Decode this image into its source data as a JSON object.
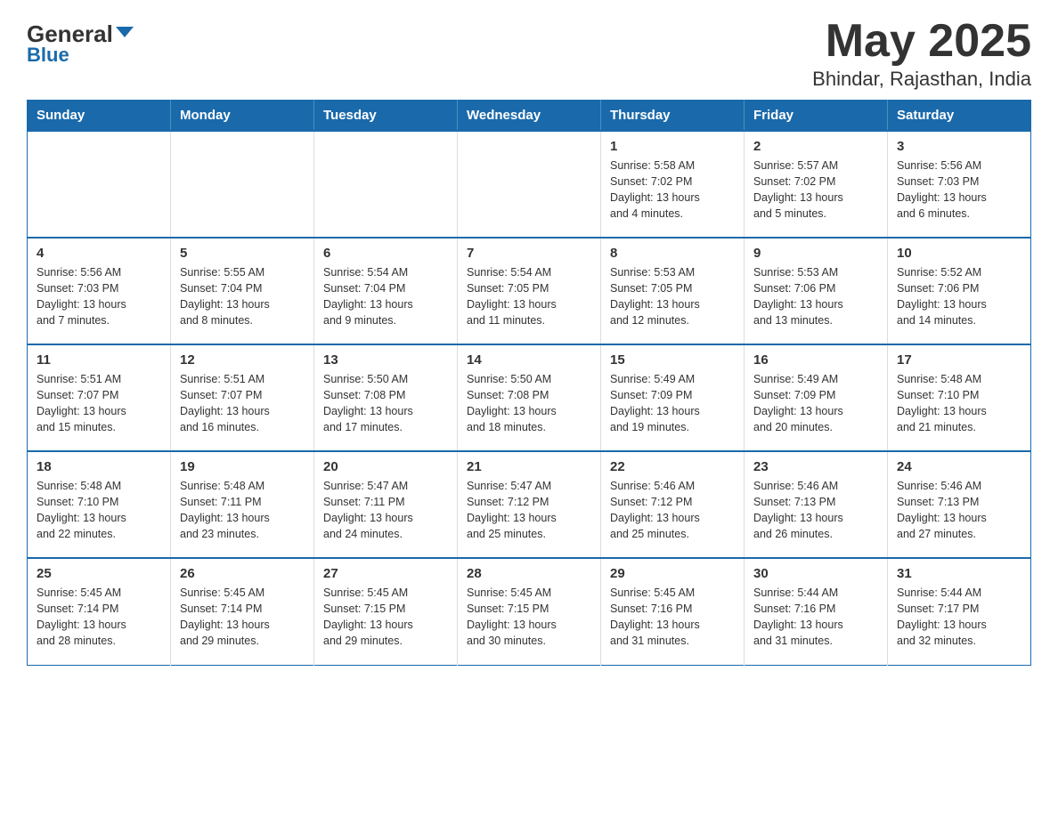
{
  "header": {
    "logo_general": "General",
    "logo_blue": "Blue",
    "month": "May 2025",
    "location": "Bhindar, Rajasthan, India"
  },
  "days_of_week": [
    "Sunday",
    "Monday",
    "Tuesday",
    "Wednesday",
    "Thursday",
    "Friday",
    "Saturday"
  ],
  "weeks": [
    {
      "days": [
        {
          "num": "",
          "info": ""
        },
        {
          "num": "",
          "info": ""
        },
        {
          "num": "",
          "info": ""
        },
        {
          "num": "",
          "info": ""
        },
        {
          "num": "1",
          "info": "Sunrise: 5:58 AM\nSunset: 7:02 PM\nDaylight: 13 hours\nand 4 minutes."
        },
        {
          "num": "2",
          "info": "Sunrise: 5:57 AM\nSunset: 7:02 PM\nDaylight: 13 hours\nand 5 minutes."
        },
        {
          "num": "3",
          "info": "Sunrise: 5:56 AM\nSunset: 7:03 PM\nDaylight: 13 hours\nand 6 minutes."
        }
      ]
    },
    {
      "days": [
        {
          "num": "4",
          "info": "Sunrise: 5:56 AM\nSunset: 7:03 PM\nDaylight: 13 hours\nand 7 minutes."
        },
        {
          "num": "5",
          "info": "Sunrise: 5:55 AM\nSunset: 7:04 PM\nDaylight: 13 hours\nand 8 minutes."
        },
        {
          "num": "6",
          "info": "Sunrise: 5:54 AM\nSunset: 7:04 PM\nDaylight: 13 hours\nand 9 minutes."
        },
        {
          "num": "7",
          "info": "Sunrise: 5:54 AM\nSunset: 7:05 PM\nDaylight: 13 hours\nand 11 minutes."
        },
        {
          "num": "8",
          "info": "Sunrise: 5:53 AM\nSunset: 7:05 PM\nDaylight: 13 hours\nand 12 minutes."
        },
        {
          "num": "9",
          "info": "Sunrise: 5:53 AM\nSunset: 7:06 PM\nDaylight: 13 hours\nand 13 minutes."
        },
        {
          "num": "10",
          "info": "Sunrise: 5:52 AM\nSunset: 7:06 PM\nDaylight: 13 hours\nand 14 minutes."
        }
      ]
    },
    {
      "days": [
        {
          "num": "11",
          "info": "Sunrise: 5:51 AM\nSunset: 7:07 PM\nDaylight: 13 hours\nand 15 minutes."
        },
        {
          "num": "12",
          "info": "Sunrise: 5:51 AM\nSunset: 7:07 PM\nDaylight: 13 hours\nand 16 minutes."
        },
        {
          "num": "13",
          "info": "Sunrise: 5:50 AM\nSunset: 7:08 PM\nDaylight: 13 hours\nand 17 minutes."
        },
        {
          "num": "14",
          "info": "Sunrise: 5:50 AM\nSunset: 7:08 PM\nDaylight: 13 hours\nand 18 minutes."
        },
        {
          "num": "15",
          "info": "Sunrise: 5:49 AM\nSunset: 7:09 PM\nDaylight: 13 hours\nand 19 minutes."
        },
        {
          "num": "16",
          "info": "Sunrise: 5:49 AM\nSunset: 7:09 PM\nDaylight: 13 hours\nand 20 minutes."
        },
        {
          "num": "17",
          "info": "Sunrise: 5:48 AM\nSunset: 7:10 PM\nDaylight: 13 hours\nand 21 minutes."
        }
      ]
    },
    {
      "days": [
        {
          "num": "18",
          "info": "Sunrise: 5:48 AM\nSunset: 7:10 PM\nDaylight: 13 hours\nand 22 minutes."
        },
        {
          "num": "19",
          "info": "Sunrise: 5:48 AM\nSunset: 7:11 PM\nDaylight: 13 hours\nand 23 minutes."
        },
        {
          "num": "20",
          "info": "Sunrise: 5:47 AM\nSunset: 7:11 PM\nDaylight: 13 hours\nand 24 minutes."
        },
        {
          "num": "21",
          "info": "Sunrise: 5:47 AM\nSunset: 7:12 PM\nDaylight: 13 hours\nand 25 minutes."
        },
        {
          "num": "22",
          "info": "Sunrise: 5:46 AM\nSunset: 7:12 PM\nDaylight: 13 hours\nand 25 minutes."
        },
        {
          "num": "23",
          "info": "Sunrise: 5:46 AM\nSunset: 7:13 PM\nDaylight: 13 hours\nand 26 minutes."
        },
        {
          "num": "24",
          "info": "Sunrise: 5:46 AM\nSunset: 7:13 PM\nDaylight: 13 hours\nand 27 minutes."
        }
      ]
    },
    {
      "days": [
        {
          "num": "25",
          "info": "Sunrise: 5:45 AM\nSunset: 7:14 PM\nDaylight: 13 hours\nand 28 minutes."
        },
        {
          "num": "26",
          "info": "Sunrise: 5:45 AM\nSunset: 7:14 PM\nDaylight: 13 hours\nand 29 minutes."
        },
        {
          "num": "27",
          "info": "Sunrise: 5:45 AM\nSunset: 7:15 PM\nDaylight: 13 hours\nand 29 minutes."
        },
        {
          "num": "28",
          "info": "Sunrise: 5:45 AM\nSunset: 7:15 PM\nDaylight: 13 hours\nand 30 minutes."
        },
        {
          "num": "29",
          "info": "Sunrise: 5:45 AM\nSunset: 7:16 PM\nDaylight: 13 hours\nand 31 minutes."
        },
        {
          "num": "30",
          "info": "Sunrise: 5:44 AM\nSunset: 7:16 PM\nDaylight: 13 hours\nand 31 minutes."
        },
        {
          "num": "31",
          "info": "Sunrise: 5:44 AM\nSunset: 7:17 PM\nDaylight: 13 hours\nand 32 minutes."
        }
      ]
    }
  ]
}
